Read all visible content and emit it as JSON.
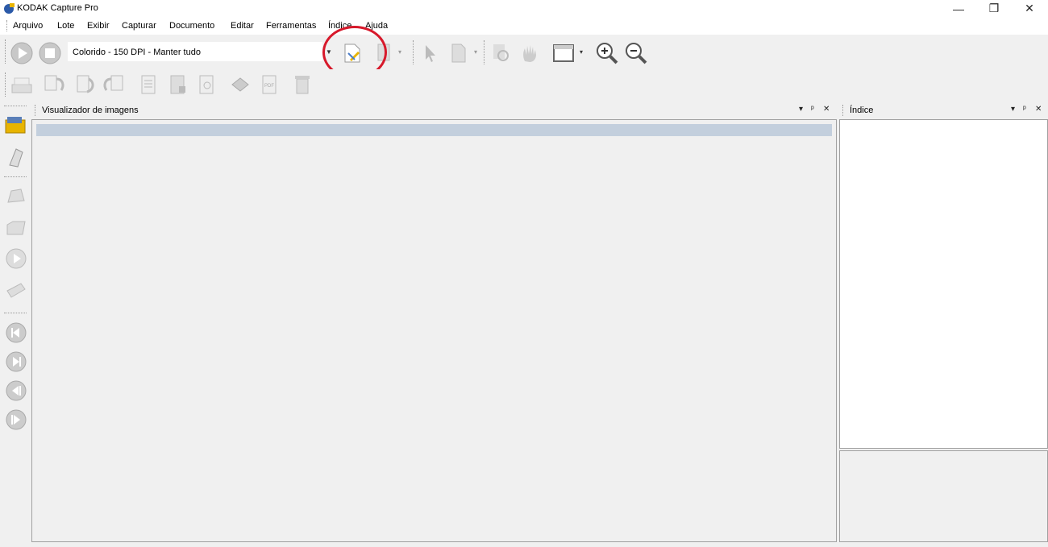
{
  "window": {
    "title": "KODAK Capture Pro",
    "minimize": "—",
    "restore": "❐",
    "close": "✕"
  },
  "menu": [
    "Arquivo",
    "Lote",
    "Exibir",
    "Capturar",
    "Documento",
    "Editar",
    "Ferramentas",
    "Índice",
    "Ajuda"
  ],
  "toolbar": {
    "setting_value": "Colorido - 150 DPI - Manter tudo"
  },
  "panels": {
    "viewer_title": "Visualizador de imagens",
    "index_title": "Índice",
    "controls": {
      "dropdown": "▾",
      "pin": "ᵖ",
      "close": "✕"
    }
  },
  "colors": {
    "highlight_circle": "#d7192b",
    "selection_bar": "#c3cfdd"
  }
}
